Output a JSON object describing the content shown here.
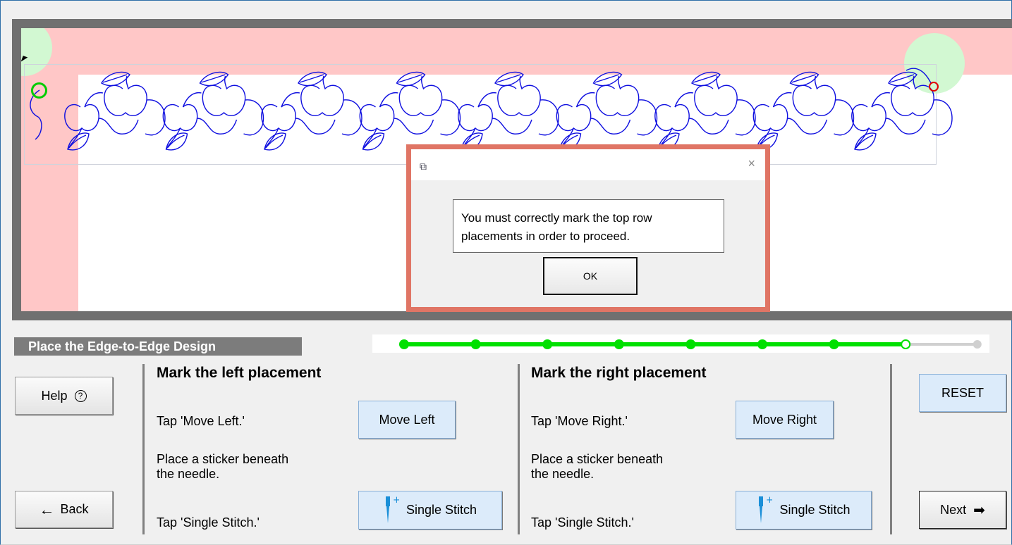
{
  "dialog": {
    "message_line1": "You must correctly mark the top row",
    "message_line2": "placements in order to proceed.",
    "ok_label": "OK",
    "close_glyph": "×",
    "app_icon_glyph": "⧉"
  },
  "progress": {
    "step_title": "Place the Edge-to-Edge Design",
    "total_steps": 9,
    "completed_steps": 7,
    "current_step": 8,
    "colors": {
      "done": "#00e000",
      "pending": "#d0d0d0"
    }
  },
  "left_panel": {
    "heading": "Mark the left placement",
    "instruction1": "Tap 'Move Left.'",
    "move_label": "Move Left",
    "instruction2_line1": "Place a sticker beneath",
    "instruction2_line2": "the needle.",
    "instruction3": "Tap 'Single Stitch.'",
    "stitch_label": "Single Stitch"
  },
  "right_panel": {
    "heading": "Mark the right placement",
    "instruction1": "Tap 'Move Right.'",
    "move_label": "Move Right",
    "instruction2_line1": "Place a sticker beneath",
    "instruction2_line2": "the needle.",
    "instruction3": "Tap 'Single Stitch.'",
    "stitch_label": "Single Stitch"
  },
  "nav": {
    "help_label": "Help",
    "help_icon": "?",
    "back_arrow": "←",
    "back_label": "Back",
    "reset_label": "RESET",
    "next_label": "Next",
    "next_arrow": "➡"
  },
  "canvas": {
    "design_name": "apple-leaf-edge-to-edge",
    "repeat_count": 9,
    "colors": {
      "stitch": "#1010e0",
      "quilt_edge": "#ffc7c7",
      "placement_zone": "#d2f8d2",
      "left_marker": "#00cc00",
      "right_marker": "#e00000"
    }
  }
}
